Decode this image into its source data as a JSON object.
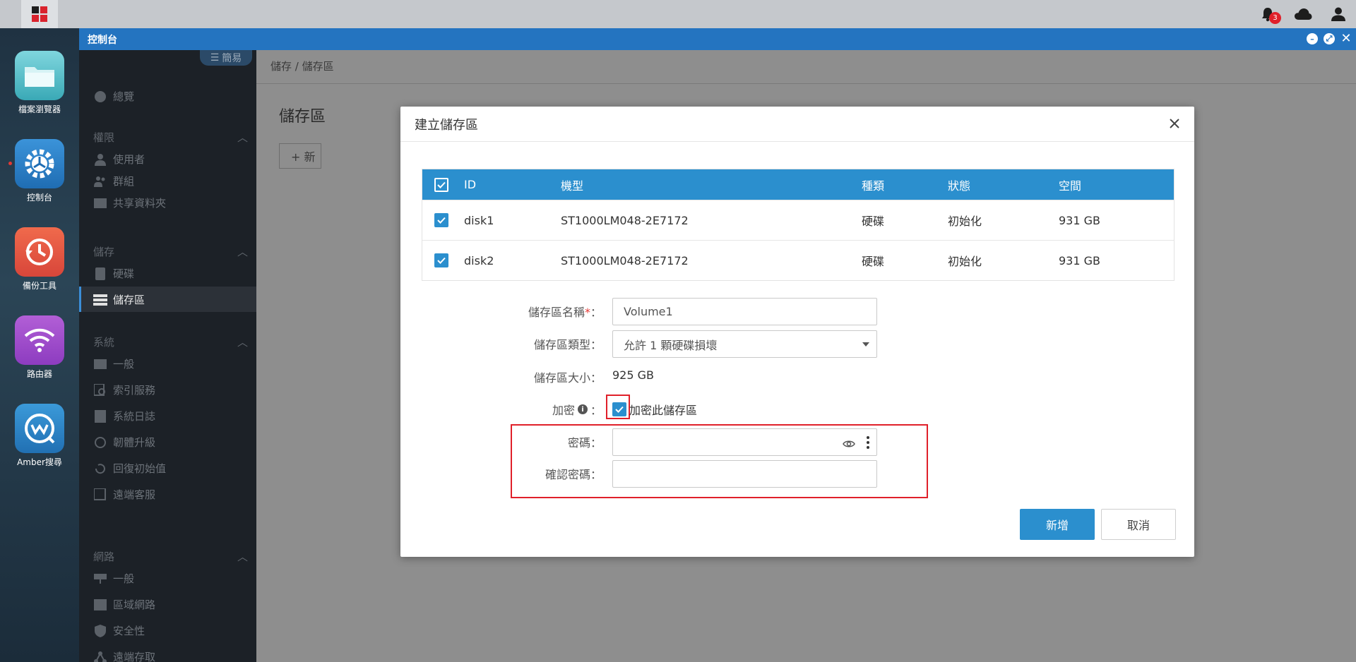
{
  "window": {
    "title": "控制台"
  },
  "desktop": {
    "apps": [
      {
        "label": "檔案瀏覽器",
        "icon": "folder-icon"
      },
      {
        "label": "控制台",
        "icon": "gear-icon"
      },
      {
        "label": "備份工具",
        "icon": "clock-backup-icon"
      },
      {
        "label": "路由器",
        "icon": "wifi-icon"
      },
      {
        "label": "Amber搜尋",
        "icon": "amber-search-icon"
      }
    ]
  },
  "topbar": {
    "notification_count": "3"
  },
  "sidebar": {
    "simple_toggle": "簡易",
    "overview": "總覽",
    "sections": {
      "permissions": "權限",
      "storage": "儲存",
      "system": "系統",
      "network": "網路"
    },
    "items": {
      "users": "使用者",
      "groups": "群組",
      "shared_folders": "共享資料夾",
      "disks": "硬碟",
      "volumes": "儲存區",
      "general": "一般",
      "index_service": "索引服務",
      "system_log": "系統日誌",
      "firmware": "韌體升級",
      "reset": "回復初始值",
      "remote_support": "遠端客服",
      "net_general": "一般",
      "lan": "區域網路",
      "security": "安全性",
      "remote_access": "遠端存取"
    }
  },
  "main": {
    "breadcrumb": "儲存 / 儲存區",
    "title": "儲存區",
    "new_button": "+ 新"
  },
  "modal": {
    "title": "建立儲存區",
    "table": {
      "headers": [
        "ID",
        "機型",
        "種類",
        "狀態",
        "空間"
      ],
      "rows": [
        {
          "id": "disk1",
          "model": "ST1000LM048-2E7172",
          "type": "硬碟",
          "status": "初始化",
          "space": "931 GB"
        },
        {
          "id": "disk2",
          "model": "ST1000LM048-2E7172",
          "type": "硬碟",
          "status": "初始化",
          "space": "931 GB"
        }
      ]
    },
    "form": {
      "name_label": "儲存區名稱",
      "required_mark": "*",
      "colon": "：",
      "name_value": "Volume1",
      "type_label": "儲存區類型",
      "type_value": "允許 1 顆硬碟損壞",
      "size_label": "儲存區大小",
      "size_value": "925 GB",
      "encrypt_label": "加密",
      "encrypt_checkbox_label": "加密此儲存區",
      "password_label": "密碼",
      "confirm_label": "確認密碼"
    },
    "buttons": {
      "add": "新增",
      "cancel": "取消"
    }
  },
  "colors": {
    "accent": "#2b8fce",
    "title_bar": "#2474c0",
    "highlight": "#e0202a"
  }
}
